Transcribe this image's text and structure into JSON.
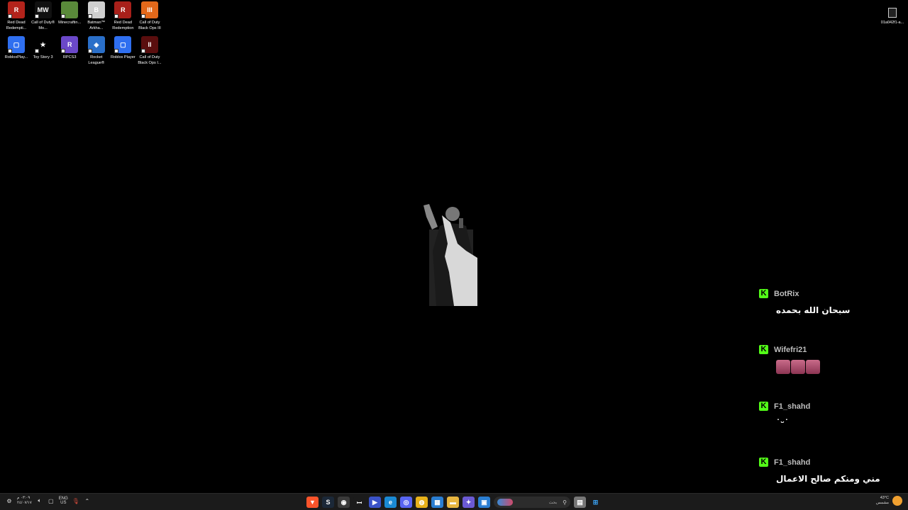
{
  "desktop": {
    "icons": [
      {
        "label": "Red Dead Redempti...",
        "icon": "red-dead-redemption-2-icon",
        "color": "#b3231b",
        "glyph": "R"
      },
      {
        "label": "Call of Duty® Mo...",
        "icon": "call-of-duty-mw2-icon",
        "color": "#111111",
        "glyph": "MW"
      },
      {
        "label": "Minecraftin...",
        "icon": "minecraft-icon",
        "color": "#5a8a3a",
        "glyph": ""
      },
      {
        "label": "Batman™ Arkha...",
        "icon": "batman-arkham-icon",
        "color": "#cfcfcf",
        "glyph": "B"
      },
      {
        "label": "Red Dead Redemption",
        "icon": "red-dead-redemption-icon",
        "color": "#a8201a",
        "glyph": "R"
      },
      {
        "label": "Call of Duty Black Ops III",
        "icon": "black-ops-3-icon",
        "color": "#e2681a",
        "glyph": "III"
      },
      {
        "label": "RobloxPlay...",
        "icon": "roblox-player-icon",
        "color": "#2f6ff0",
        "glyph": "▢"
      },
      {
        "label": "Toy Story 3",
        "icon": "toy-story-3-icon",
        "color": "#000000",
        "glyph": "★"
      },
      {
        "label": "RPCS3",
        "icon": "rpcs3-icon",
        "color": "#6b48c9",
        "glyph": "R"
      },
      {
        "label": "Rocket League®",
        "icon": "rocket-league-icon",
        "color": "#2a6fc9",
        "glyph": "◈"
      },
      {
        "label": "Roblox Player",
        "icon": "roblox-player-icon",
        "color": "#2f6ff0",
        "glyph": "▢"
      },
      {
        "label": "Call of Duty Black Ops I...",
        "icon": "black-ops-icon",
        "color": "#5a0e0e",
        "glyph": "II"
      }
    ],
    "top_right_file": {
      "label": "01a042f1-a...",
      "icon": "file-icon"
    }
  },
  "chat": {
    "messages": [
      {
        "user": "BotRix",
        "text": "سبحان الله بحمده",
        "kind": "text"
      },
      {
        "user": "Wifefri21",
        "text": "",
        "kind": "emotes",
        "emote_count": 3
      },
      {
        "user": "F1_shahd",
        "text": "˙ᵕ˙",
        "kind": "text"
      },
      {
        "user": "F1_shahd",
        "text": "مني ومنكم صالح الاعمال",
        "kind": "text"
      }
    ],
    "badge_glyph": "K",
    "badge_color": "#53fc18"
  },
  "taskbar": {
    "clock_time": "٠٣:٠٩ م",
    "clock_date": "٢٤/٠٧/١٧",
    "language": "ENG",
    "region": "US",
    "search_placeholder": "بحث",
    "weather_temp": "43°C",
    "weather_desc": "مشمس",
    "apps": [
      {
        "icon": "brave-icon",
        "color": "#fb542b",
        "glyph": "▼"
      },
      {
        "icon": "steam-icon",
        "color": "#1b2838",
        "glyph": "S"
      },
      {
        "icon": "obs-icon",
        "color": "#3a3a3a",
        "glyph": "◉"
      },
      {
        "icon": "app-icon",
        "color": "#1b1b1b",
        "glyph": "ꟷ"
      },
      {
        "icon": "media-player-icon",
        "color": "#3a52c8",
        "glyph": "▶"
      },
      {
        "icon": "edge-icon",
        "color": "#1a8ad4",
        "glyph": "e"
      },
      {
        "icon": "discord-icon",
        "color": "#5865f2",
        "glyph": "◎"
      },
      {
        "icon": "chrome-icon",
        "color": "#e8b21a",
        "glyph": "◍"
      },
      {
        "icon": "store-icon",
        "color": "#2a7ed2",
        "glyph": "▦"
      },
      {
        "icon": "folder-icon",
        "color": "#e8b640",
        "glyph": "▬"
      },
      {
        "icon": "copilot-icon",
        "color": "#6b5ad4",
        "glyph": "✦"
      },
      {
        "icon": "window-icon",
        "color": "#2a7ed2",
        "glyph": "▣"
      },
      {
        "icon": "notepad-icon",
        "color": "#777777",
        "glyph": "▤"
      }
    ]
  }
}
